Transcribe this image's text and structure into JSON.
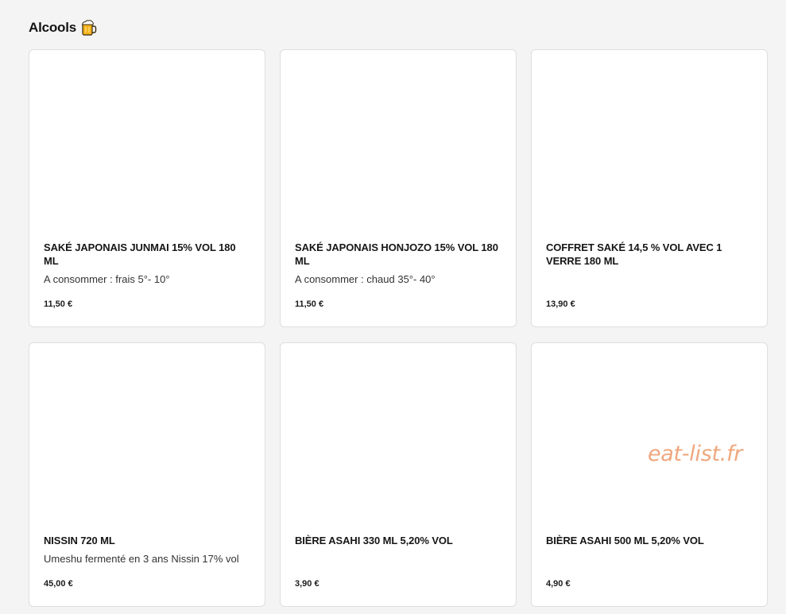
{
  "section": {
    "title": "Alcools",
    "icon": "beer-mug-icon"
  },
  "products": [
    {
      "title": "SAKÉ JAPONAIS JUNMAI 15% VOL 180 ML",
      "description": "A consommer : frais 5°- 10°",
      "price": "11,50 €"
    },
    {
      "title": "SAKÉ JAPONAIS HONJOZO 15% VOL 180 ML",
      "description": "A consommer : chaud 35°- 40°",
      "price": "11,50 €"
    },
    {
      "title": "COFFRET SAKÉ 14,5 % VOL AVEC 1 VERRE 180 ML",
      "description": "",
      "price": "13,90 €"
    },
    {
      "title": "NISSIN 720 ML",
      "description": "Umeshu fermenté en 3 ans Nissin 17% vol",
      "price": "45,00 €"
    },
    {
      "title": "BIÈRE ASAHI 330 ML 5,20% VOL",
      "description": "",
      "price": "3,90 €"
    },
    {
      "title": "BIÈRE ASAHI 500 ML 5,20% VOL",
      "description": "",
      "price": "4,90 €"
    }
  ],
  "watermark": "eat-list.fr",
  "colors": {
    "background": "#f4f4f4",
    "card": "#ffffff",
    "watermark": "#f0a77e"
  }
}
